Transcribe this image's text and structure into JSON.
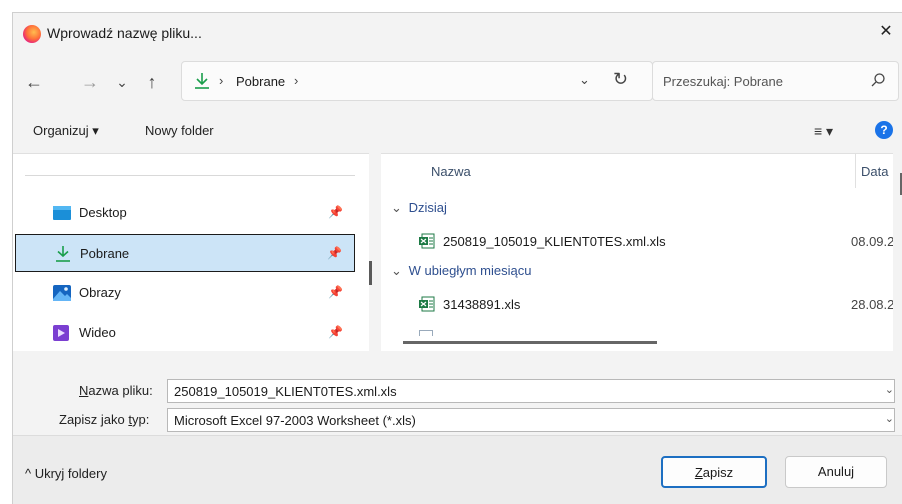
{
  "window": {
    "title": "Wprowadź nazwę pliku...",
    "close_glyph": "✕"
  },
  "nav": {
    "back_glyph": "←",
    "forward_glyph": "→",
    "recent_glyph": "⌄",
    "up_glyph": "↑"
  },
  "address": {
    "separator": "›",
    "crumb": "Pobrane",
    "dropdown_glyph": "⌄",
    "refresh_glyph": "↻"
  },
  "search": {
    "placeholder": "Przeszukaj: Pobrane"
  },
  "toolbar": {
    "organize_label": "Organizuj ▾",
    "new_folder_label": "Nowy folder",
    "view_glyph": "≡ ▾",
    "help_glyph": "?"
  },
  "sidebar": {
    "items": [
      {
        "label": "Desktop",
        "icon": "desktop-icon",
        "pin": "📌"
      },
      {
        "label": "Pobrane",
        "icon": "download-icon",
        "pin": "📌",
        "selected": true
      },
      {
        "label": "Obrazy",
        "icon": "pictures-icon",
        "pin": "📌"
      },
      {
        "label": "Wideo",
        "icon": "video-icon",
        "pin": "📌"
      }
    ]
  },
  "filelist": {
    "col_name": "Nazwa",
    "col_date": "Data r",
    "groups": [
      {
        "label": "Dzisiaj",
        "chevron": "⌄",
        "files": [
          {
            "name": "250819_105019_KLIENT0TES.xml.xls",
            "date": "08.09.2"
          }
        ]
      },
      {
        "label": "W ubiegłym miesiącu",
        "chevron": "⌄",
        "files": [
          {
            "name": "31438891.xls",
            "date": "28.08.2"
          }
        ]
      }
    ]
  },
  "form": {
    "filename_label_pre": "N",
    "filename_label_rest": "azwa pliku:",
    "filename_value": "250819_105019_KLIENT0TES.xml.xls",
    "type_label_pre": "Zapisz jako ",
    "type_label_u": "t",
    "type_label_rest": "yp:",
    "type_value": "Microsoft Excel 97-2003 Worksheet (*.xls)",
    "dropdown_glyph": "⌄"
  },
  "footer": {
    "hide_folders": "^ Ukryj foldery",
    "save_u": "Z",
    "save_rest": "apisz",
    "cancel": "Anuluj"
  },
  "colors": {
    "accent": "#1d6fc2",
    "selection_bg": "#cce4f7",
    "download_green": "#1a9e4b",
    "excel_green": "#1d7a45"
  }
}
